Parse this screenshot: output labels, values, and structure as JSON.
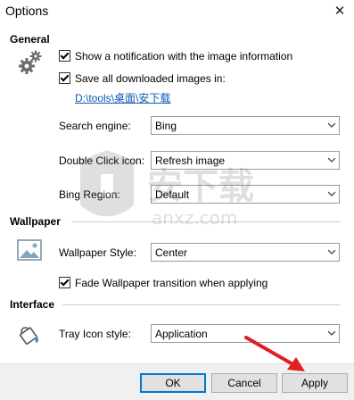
{
  "window": {
    "title": "Options",
    "close_glyph": "✕"
  },
  "general": {
    "heading": "General",
    "show_notification": {
      "label": "Show a notification with the image information",
      "checked": true
    },
    "save_images": {
      "label": "Save all downloaded images in:",
      "checked": true
    },
    "save_path": "D:\\tools\\桌面\\安下载",
    "search_engine": {
      "label": "Search engine:",
      "value": "Bing"
    },
    "double_click": {
      "label": "Double Click icon:",
      "value": "Refresh image"
    },
    "bing_region": {
      "label": "Bing Region:",
      "value": "Default"
    }
  },
  "wallpaper": {
    "heading": "Wallpaper",
    "style": {
      "label": "Wallpaper Style:",
      "value": "Center"
    },
    "fade": {
      "label": "Fade Wallpaper transition when applying",
      "checked": true
    }
  },
  "interface": {
    "heading": "Interface",
    "tray": {
      "label": "Tray Icon style:",
      "value": "Application"
    }
  },
  "footer": {
    "ok": "OK",
    "cancel": "Cancel",
    "apply": "Apply"
  },
  "watermark": {
    "text": "anxz.com"
  },
  "colors": {
    "link": "#0b5bb5",
    "accent": "#0078d7",
    "arrow": "#e02020"
  }
}
